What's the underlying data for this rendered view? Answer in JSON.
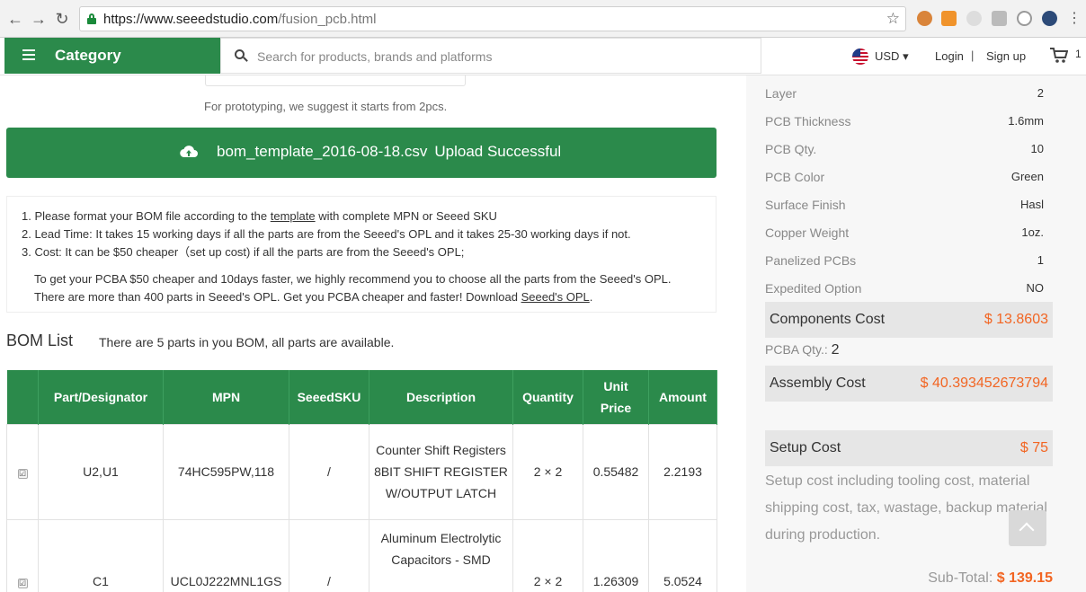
{
  "browser": {
    "url_host": "https://www.seeedstudio.com",
    "url_path": "/fusion_pcb.html"
  },
  "header": {
    "category_label": "Category",
    "search_placeholder": "Search for products, brands and platforms",
    "currency": "USD",
    "login": "Login",
    "separator": "|",
    "signup": "Sign up",
    "cart_count": "1"
  },
  "main": {
    "qty_hint": "For prototyping, we suggest it starts from 2pcs.",
    "upload_filename": "bom_template_2016-08-18.csv",
    "upload_status": "Upload Successful",
    "notes": {
      "item1_prefix": "1. Please format your BOM file according to the ",
      "item1_link": "template",
      "item1_suffix": " with complete MPN or Seeed SKU",
      "item2": "2. Lead Time: It takes 15 working days if all the parts are from the Seeed's OPL and it takes 25-30 working days if not.",
      "item3": "3. Cost: It can be $50 cheaper（set up cost) if all the parts are from the Seeed's OPL;",
      "para_line1": "To get your PCBA $50 cheaper and 10days faster, we highly recommend you to choose all the parts from the Seeed's OPL.",
      "para_line2_prefix": "There are more than 400 parts in Seeed's OPL. Get you PCBA cheaper and faster! Download ",
      "para_link": "Seeed's OPL",
      "para_line2_suffix": "."
    },
    "bom_title": "BOM List",
    "bom_subtitle": "There are 5 parts in you BOM, all parts are available."
  },
  "bom_table": {
    "headers": [
      "",
      "Part/Designator",
      "MPN",
      "SeeedSKU",
      "Description",
      "Quantity",
      "Unit Price",
      "Amount"
    ],
    "rows": [
      {
        "checked": "☑",
        "designator": "U2,U1",
        "mpn": "74HC595PW,118",
        "sku": "/",
        "description": "Counter Shift Registers 8BIT SHIFT REGISTER W/OUTPUT LATCH",
        "quantity": "2 × 2",
        "unit_price": "0.55482",
        "amount": "2.2193"
      },
      {
        "checked": "☑",
        "designator": "C1",
        "mpn": "UCL0J222MNL1GS",
        "sku": "/",
        "description": "Aluminum Electrolytic Capacitors - SMD",
        "quantity": "2 × 2",
        "unit_price": "1.26309",
        "amount": "5.0524"
      }
    ]
  },
  "sidebar": {
    "specs": [
      {
        "label": "Layer",
        "value": "2"
      },
      {
        "label": "PCB Thickness",
        "value": "1.6mm"
      },
      {
        "label": "PCB Qty.",
        "value": "10"
      },
      {
        "label": "PCB Color",
        "value": "Green"
      },
      {
        "label": "Surface Finish",
        "value": "Hasl"
      },
      {
        "label": "Copper Weight",
        "value": "1oz."
      },
      {
        "label": "Panelized PCBs",
        "value": "1"
      },
      {
        "label": "Expedited Option",
        "value": "NO"
      }
    ],
    "components_cost_label": "Components Cost",
    "components_cost_value": "$ 13.8603",
    "pcba_qty_label": "PCBA Qty.:",
    "pcba_qty_value": "2",
    "assembly_cost_label": "Assembly Cost",
    "assembly_cost_value": "$ 40.393452673794",
    "setup_cost_label": "Setup Cost",
    "setup_cost_value": "$ 75",
    "setup_note": "Setup cost including tooling cost, material shipping cost, tax, wastage, backup material during production.",
    "subtotal_label": "Sub-Total:",
    "subtotal_value": "$ 139.15"
  },
  "colors": {
    "brand_green": "#2b8a4b",
    "price_orange": "#f26522"
  }
}
